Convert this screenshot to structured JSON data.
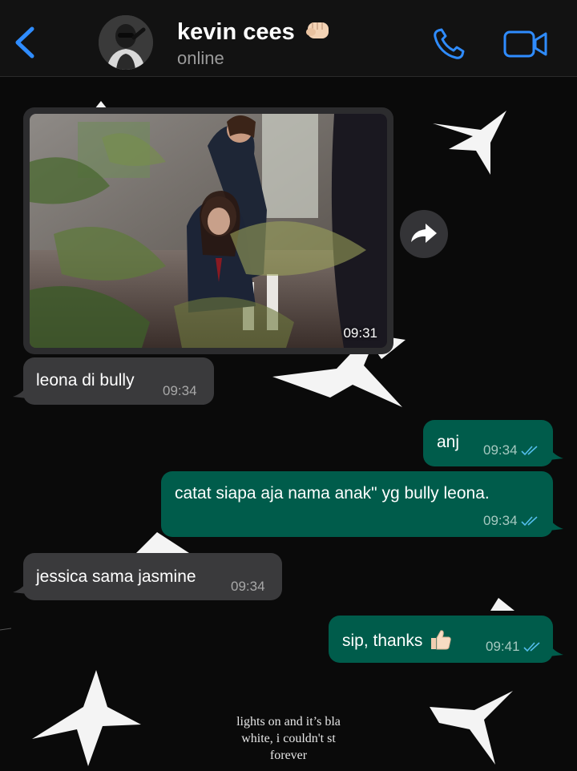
{
  "header": {
    "contact_name": "kevin cees",
    "name_emoji": "fist-emoji",
    "status": "online"
  },
  "background": {
    "caption": "lights on and it's black white, i couldn't stay forever",
    "caption_line1": "lights on and it’s bla",
    "caption_line2": "white, i couldn't st",
    "caption_line3": "forever"
  },
  "messages": [
    {
      "direction": "incoming",
      "type": "photo",
      "time": "09:31"
    },
    {
      "direction": "incoming",
      "text": "leona di bully",
      "time": "09:34"
    },
    {
      "direction": "outgoing",
      "text": "anj",
      "time": "09:34",
      "read": true
    },
    {
      "direction": "outgoing",
      "text": "catat siapa aja nama anak\" yg bully leona.",
      "time": "09:34",
      "read": true
    },
    {
      "direction": "incoming",
      "text": "jessica sama jasmine",
      "time": "09:34"
    },
    {
      "direction": "outgoing",
      "text": "sip, thanks",
      "emoji": "thumbs-up",
      "time": "09:41",
      "read": true
    }
  ],
  "colors": {
    "accent_blue": "#2f8cff",
    "incoming_bubble": "#3a3a3c",
    "outgoing_bubble": "#005c4b",
    "read_ticks": "#53bdeb"
  }
}
